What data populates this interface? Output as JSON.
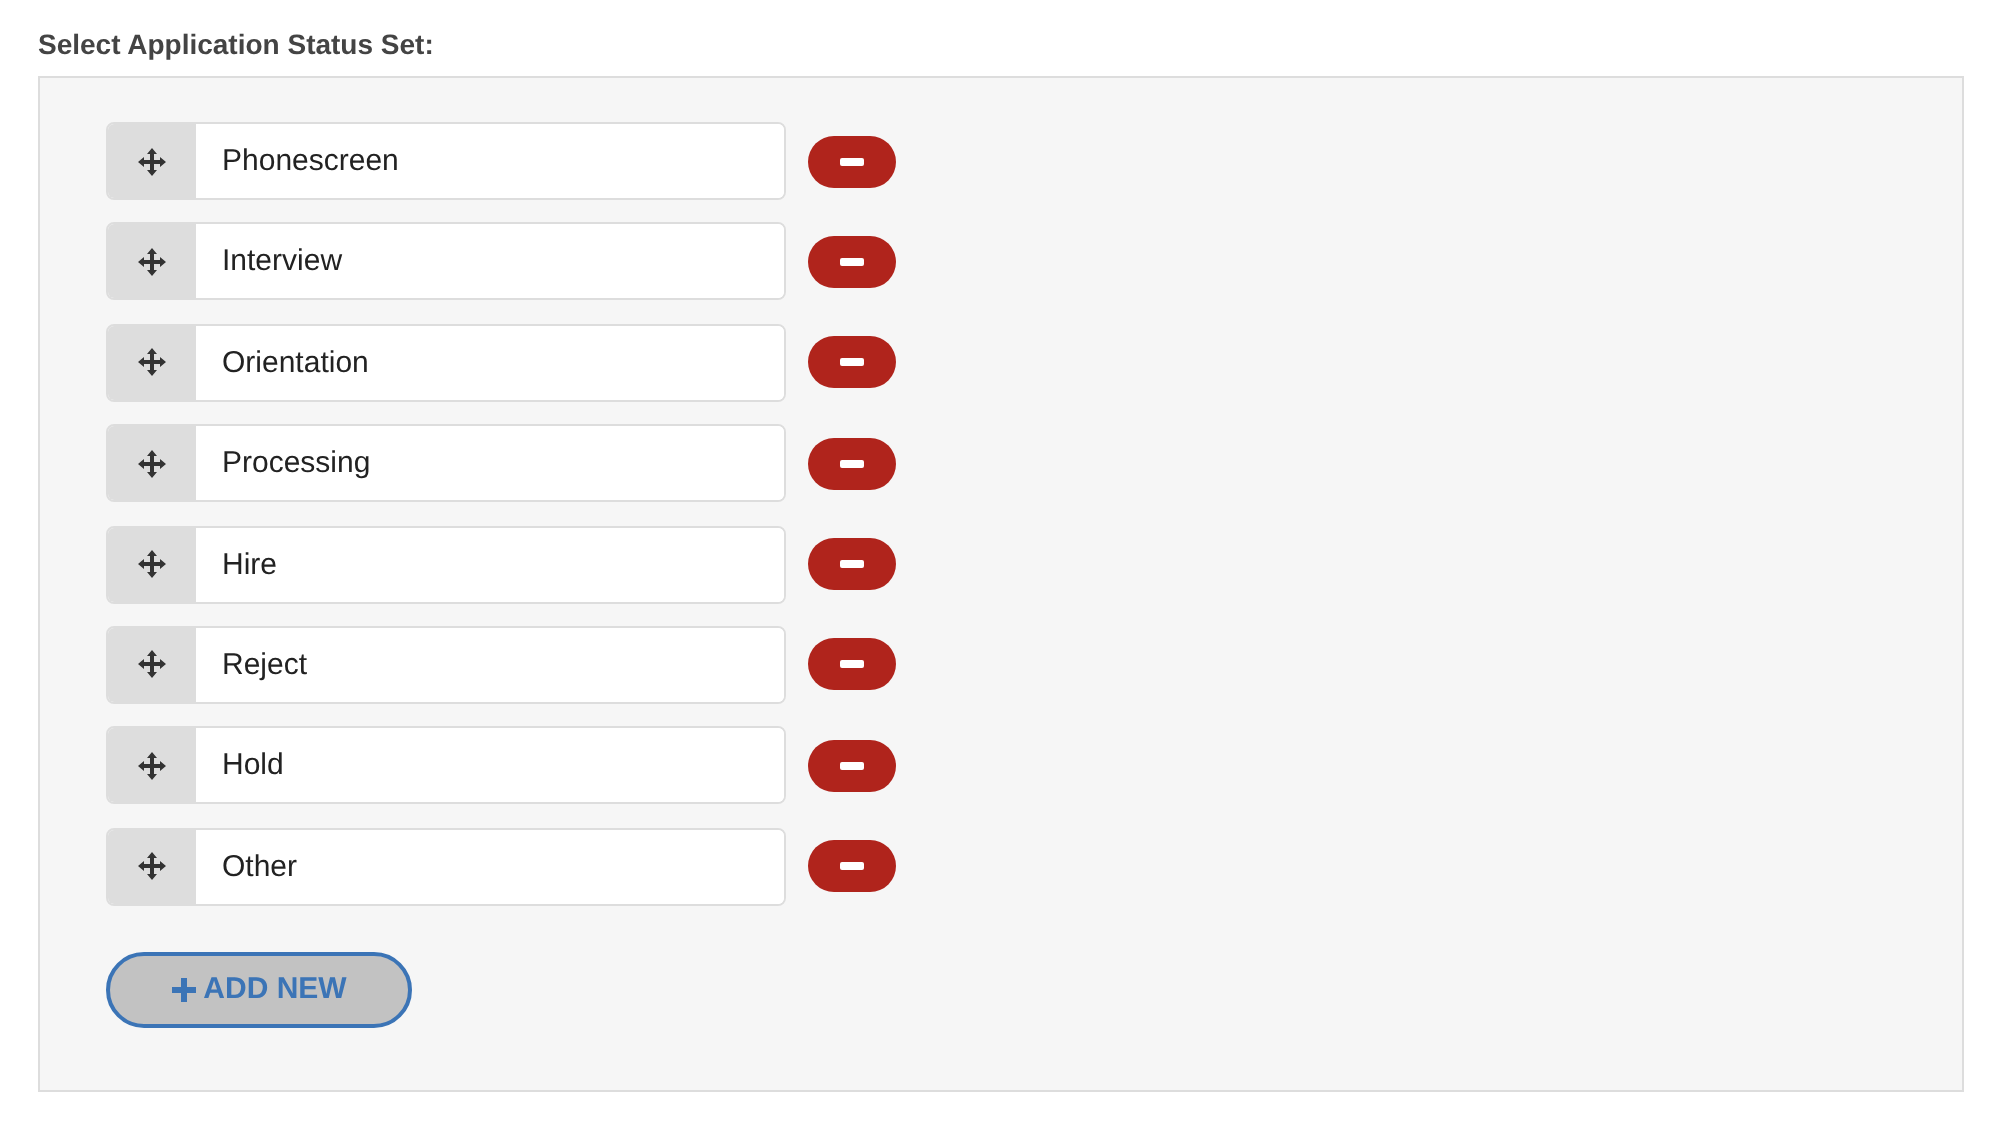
{
  "heading": "Select Application Status Set:",
  "statuses": [
    {
      "value": "Phonescreen"
    },
    {
      "value": "Interview"
    },
    {
      "value": "Orientation"
    },
    {
      "value": "Processing"
    },
    {
      "value": "Hire"
    },
    {
      "value": "Reject"
    },
    {
      "value": "Hold"
    },
    {
      "value": "Other"
    }
  ],
  "add_button": {
    "label": "ADD NEW"
  }
}
